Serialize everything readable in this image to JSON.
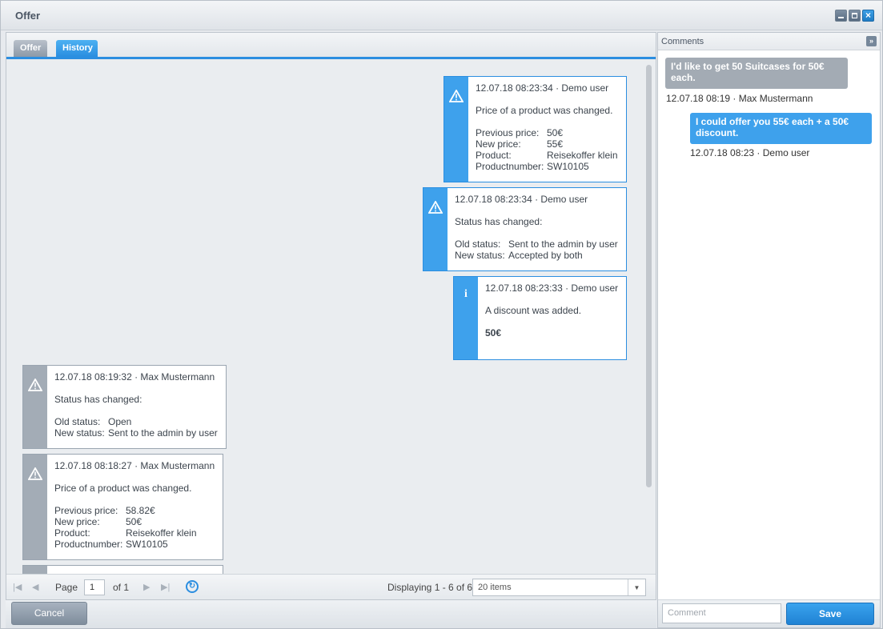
{
  "window": {
    "title": "Offer"
  },
  "tabs": [
    {
      "label": "Offer"
    },
    {
      "label": "History"
    }
  ],
  "history": [
    {
      "icon": "warning-icon",
      "header": "12.07.18 08:23:34 · Demo user",
      "description": "Price of a product was changed.",
      "rows": [
        {
          "key": "Previous price:",
          "value": "50€"
        },
        {
          "key": "New price:",
          "value": "55€"
        },
        {
          "key": "Product:",
          "value": "Reisekoffer klein"
        },
        {
          "key": "Productnumber:",
          "value": "SW10105"
        }
      ]
    },
    {
      "icon": "warning-icon",
      "header": "12.07.18 08:23:34 · Demo user",
      "description": "Status has changed:",
      "rows": [
        {
          "key": "Old status:",
          "value": "Sent to the admin by user"
        },
        {
          "key": "New status:",
          "value": "Accepted by both"
        }
      ]
    },
    {
      "icon": "info-icon",
      "header": "12.07.18 08:23:33 · Demo user",
      "description": "A discount was added.",
      "value": "50€"
    },
    {
      "icon": "warning-icon",
      "header": "12.07.18 08:19:32 · Max Mustermann",
      "description": "Status has changed:",
      "rows": [
        {
          "key": "Old status:",
          "value": "Open"
        },
        {
          "key": "New status:",
          "value": "Sent to the admin by user"
        }
      ]
    },
    {
      "icon": "warning-icon",
      "header": "12.07.18 08:18:27 · Max Mustermann",
      "description": "Price of a product was changed.",
      "rows": [
        {
          "key": "Previous price:",
          "value": "58.82€"
        },
        {
          "key": "New price:",
          "value": "50€"
        },
        {
          "key": "Product:",
          "value": "Reisekoffer klein"
        },
        {
          "key": "Productnumber:",
          "value": "SW10105"
        }
      ]
    }
  ],
  "paging": {
    "page_label": "Page",
    "page_value": "1",
    "of_label": "of 1",
    "displaying": "Displaying 1 - 6 of 6",
    "page_size": "20 items"
  },
  "buttons": {
    "cancel": "Cancel",
    "save": "Save"
  },
  "comments": {
    "title": "Comments",
    "items": [
      {
        "text": "I'd like to get 50 Suitcases for 50€ each.",
        "meta": "12.07.18 08:19 · Max Mustermann"
      },
      {
        "text": "I could offer you 55€ each + a 50€ discount.",
        "meta": "12.07.18 08:23 · Demo user"
      }
    ],
    "input_placeholder": "Comment"
  }
}
